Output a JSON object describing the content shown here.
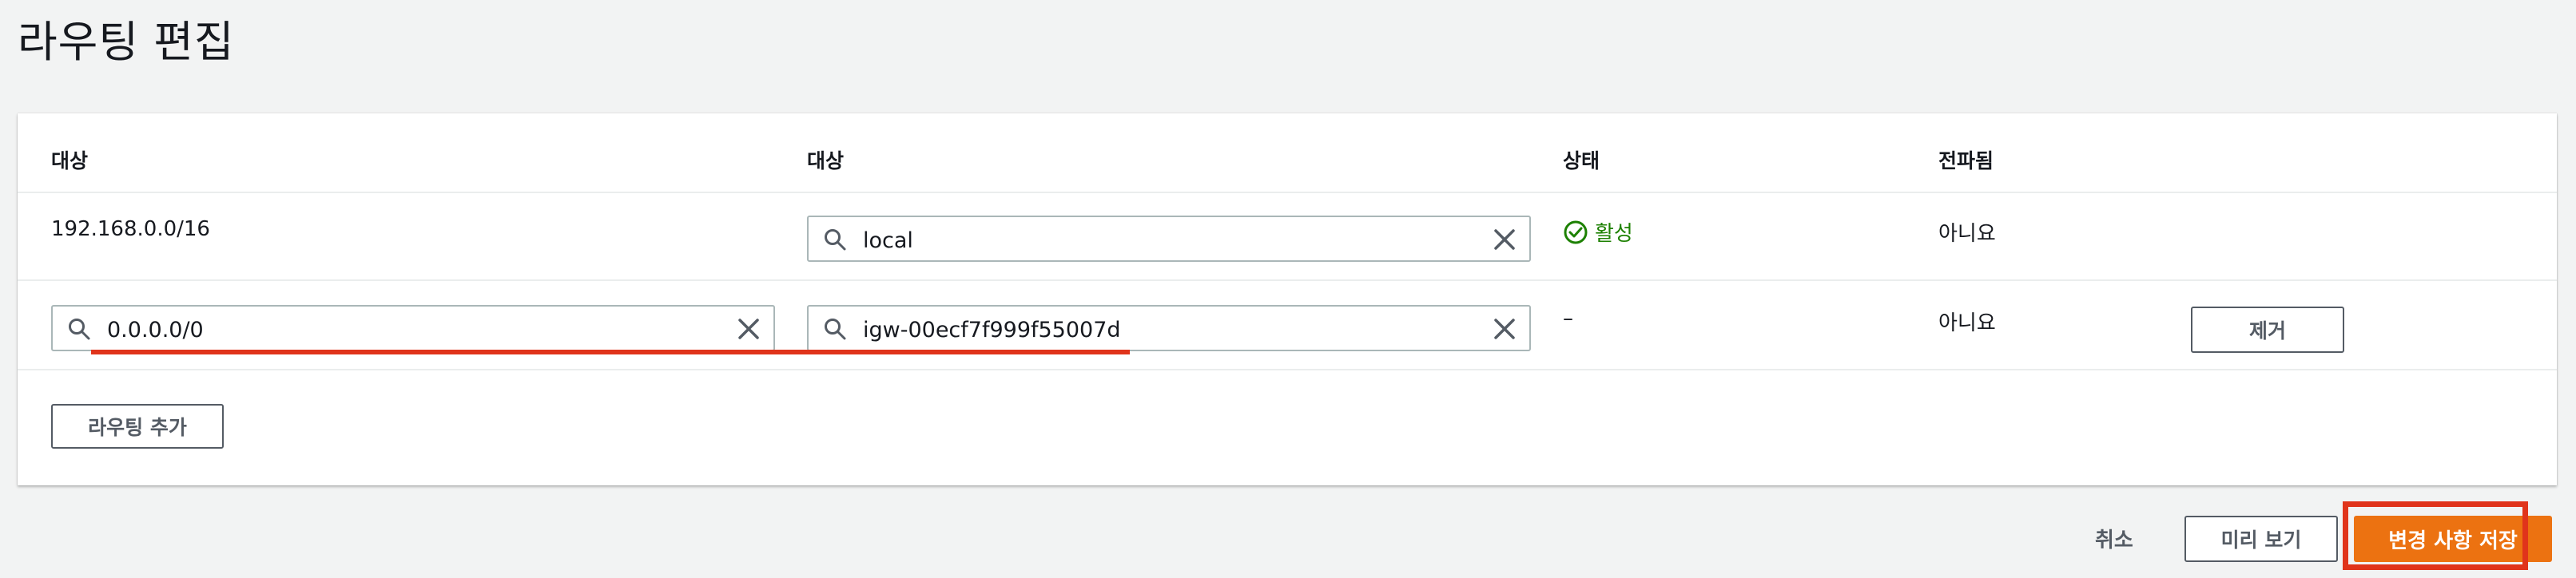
{
  "page": {
    "title": "라우팅 편집"
  },
  "table": {
    "headers": [
      "대상",
      "대상",
      "상태",
      "전파됨"
    ],
    "rows": [
      {
        "destination": "192.168.0.0/16",
        "target": "local",
        "status": "활성",
        "propagated": "아니요"
      },
      {
        "destination": "0.0.0.0/0",
        "target": "igw-00ecf7f999f55007d",
        "status": "–",
        "propagated": "아니요",
        "remove_label": "제거"
      }
    ],
    "add_route_label": "라우팅 추가"
  },
  "footer": {
    "cancel_label": "취소",
    "preview_label": "미리 보기",
    "save_label": "변경 사항 저장"
  },
  "colors": {
    "accent": "#ec7211",
    "success": "#1d8102",
    "annotation": "#e0341b"
  },
  "icons": [
    "search-icon",
    "clear-icon",
    "check-circle-icon"
  ]
}
